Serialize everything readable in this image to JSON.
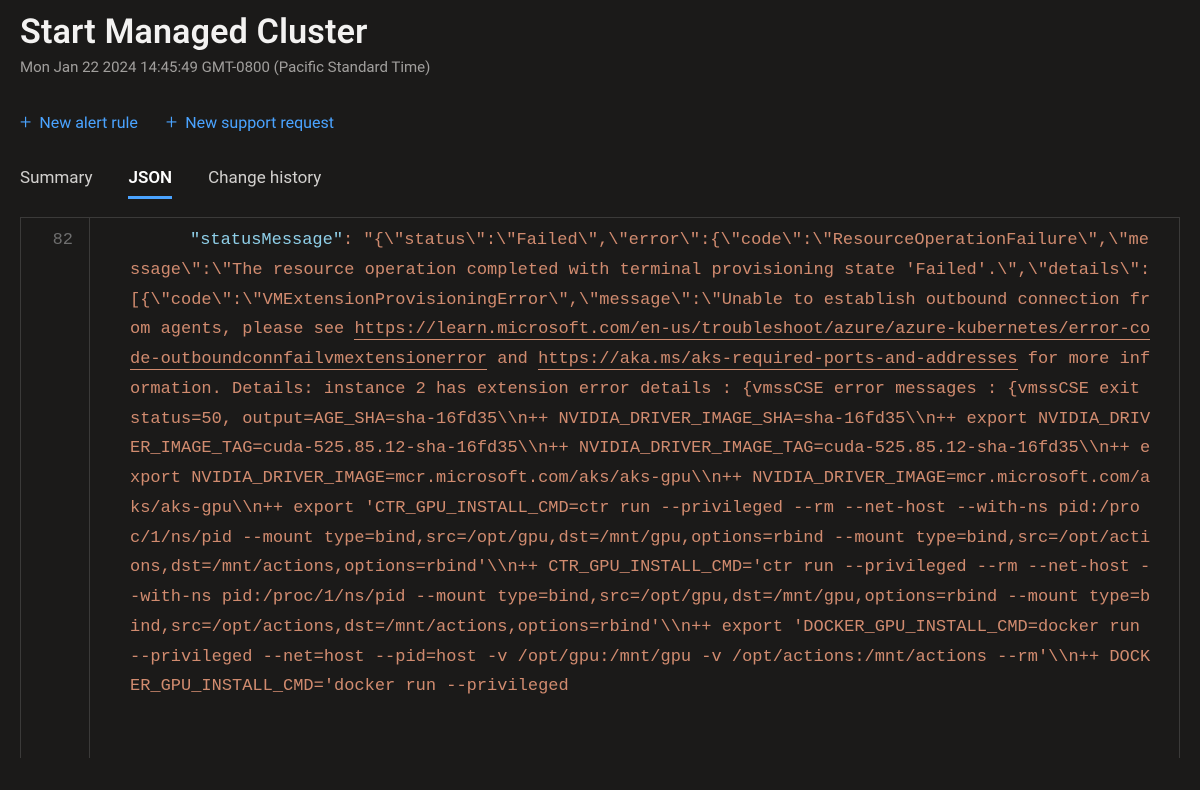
{
  "header": {
    "title": "Start Managed Cluster",
    "timestamp": "Mon Jan 22 2024 14:45:49 GMT-0800 (Pacific Standard Time)"
  },
  "commands": {
    "new_alert": "New alert rule",
    "new_support": "New support request"
  },
  "tabs": {
    "summary": "Summary",
    "json": "JSON",
    "change_history": "Change history"
  },
  "json_view": {
    "line_number": "82",
    "key": "\"statusMessage\"",
    "pre_link1": ": \"{\\\"status\\\":\\\"Failed\\\",\\\"error\\\":{\\\"code\\\":\\\"ResourceOperationFailure\\\",\\\"message\\\":\\\"The resource operation completed with terminal provisioning state 'Failed'.\\\",\\\"details\\\":[{\\\"code\\\":\\\"VMExtensionProvisioningError\\\",\\\"message\\\":\\\"Unable to establish outbound connection from agents, please see ",
    "link1_text": "https://learn.microsoft.com/en-us/troubleshoot/azure/azure-kubernetes/error-code-outboundconnfailvmextensionerror",
    "mid_text": " and ",
    "link2_text": "https://aka.ms/aks-required-ports-and-addresses",
    "post_link2": " for more information. Details: instance 2 has extension error details : {vmssCSE error messages : {vmssCSE exit status=50, output=AGE_SHA=sha-16fd35\\\\n++ NVIDIA_DRIVER_IMAGE_SHA=sha-16fd35\\\\n++ export NVIDIA_DRIVER_IMAGE_TAG=cuda-525.85.12-sha-16fd35\\\\n++ NVIDIA_DRIVER_IMAGE_TAG=cuda-525.85.12-sha-16fd35\\\\n++ export NVIDIA_DRIVER_IMAGE=mcr.microsoft.com/aks/aks-gpu\\\\n++ NVIDIA_DRIVER_IMAGE=mcr.microsoft.com/aks/aks-gpu\\\\n++ export 'CTR_GPU_INSTALL_CMD=ctr run --privileged --rm --net-host --with-ns pid:/proc/1/ns/pid --mount type=bind,src=/opt/gpu,dst=/mnt/gpu,options=rbind --mount type=bind,src=/opt/actions,dst=/mnt/actions,options=rbind'\\\\n++ CTR_GPU_INSTALL_CMD='ctr run --privileged --rm --net-host --with-ns pid:/proc/1/ns/pid --mount type=bind,src=/opt/gpu,dst=/mnt/gpu,options=rbind --mount type=bind,src=/opt/actions,dst=/mnt/actions,options=rbind'\\\\n++ export 'DOCKER_GPU_INSTALL_CMD=docker run --privileged --net=host --pid=host -v /opt/gpu:/mnt/gpu -v /opt/actions:/mnt/actions --rm'\\\\n++ DOCKER_GPU_INSTALL_CMD='docker run --privileged"
  }
}
